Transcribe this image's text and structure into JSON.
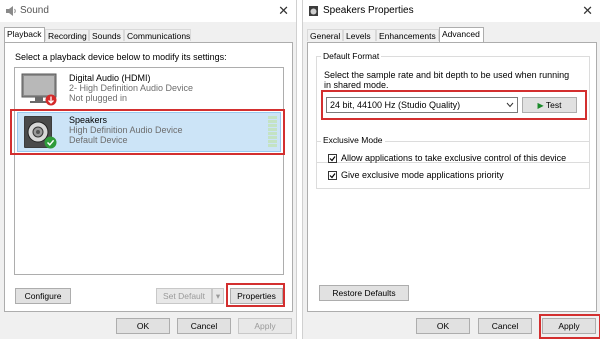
{
  "sound_window": {
    "title": "Sound",
    "close_glyph": "✕",
    "tabs": [
      "Playback",
      "Recording",
      "Sounds",
      "Communications"
    ],
    "active_tab": "Playback",
    "instruction": "Select a playback device below to modify its settings:",
    "devices": [
      {
        "name": "Digital Audio (HDMI)",
        "line2": "2- High Definition Audio Device",
        "line3": "Not plugged in",
        "icon": "monitor-icon",
        "badge": "unplugged-arrow-icon"
      },
      {
        "name": "Speakers",
        "line2": "High Definition Audio Device",
        "line3": "Default Device",
        "icon": "speaker-icon",
        "badge": "default-check-icon",
        "selected": true
      }
    ],
    "buttons": {
      "configure": "Configure",
      "set_default": "Set Default",
      "set_default_arrow": "▾",
      "properties": "Properties",
      "ok": "OK",
      "cancel": "Cancel",
      "apply": "Apply"
    }
  },
  "properties_window": {
    "title": "Speakers Properties",
    "close_glyph": "✕",
    "tabs": [
      "General",
      "Levels",
      "Enhancements",
      "Advanced"
    ],
    "active_tab": "Advanced",
    "default_format": {
      "label": "Default Format",
      "description": "Select the sample rate and bit depth to be used when running in shared mode.",
      "selected": "24 bit, 44100 Hz (Studio Quality)",
      "test_label": "Test",
      "test_icon": "▶"
    },
    "exclusive_mode": {
      "label": "Exclusive Mode",
      "options": [
        {
          "label": "Allow applications to take exclusive control of this device",
          "checked": true
        },
        {
          "label": "Give exclusive mode applications priority",
          "checked": true
        }
      ]
    },
    "buttons": {
      "restore_defaults": "Restore Defaults",
      "ok": "OK",
      "cancel": "Cancel",
      "apply": "Apply"
    }
  },
  "colors": {
    "accent_highlight": "#d32f2f",
    "selection": "#cce4f7",
    "check_green": "#2e9b3a",
    "test_green": "#1a8a2a",
    "level_meter": "#c4e3c4"
  }
}
